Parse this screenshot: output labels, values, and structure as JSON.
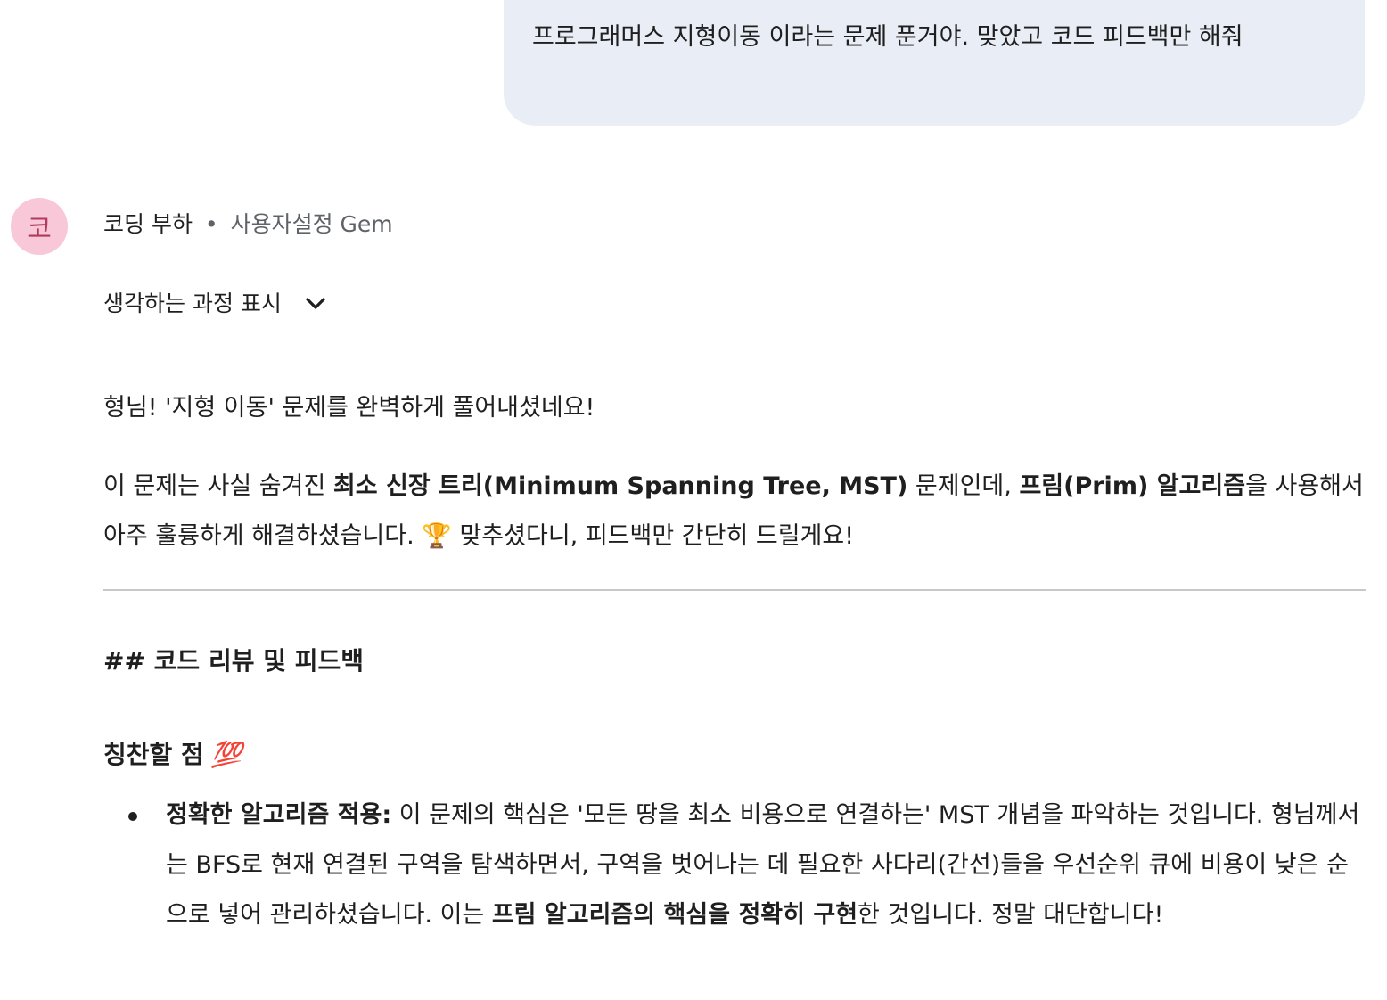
{
  "user_message": {
    "text": "프로그래머스 지형이동 이라는 문제 푼거야. 맞았고 코드 피드백만 해줘"
  },
  "assistant": {
    "avatar_letter": "코",
    "name": "코딩 부하",
    "separator": "•",
    "meta": "사용자설정 Gem",
    "thinking_toggle_label": "생각하는 과정 표시",
    "colors": {
      "avatar_bg": "#f8c8d8",
      "user_bubble_bg": "#e9eef6",
      "divider": "#c8c8c8"
    }
  },
  "response": {
    "p1": "형님! '지형 이동' 문제를 완벽하게 풀어내셨네요!",
    "p2_a": "이 문제는 사실 숨겨진 ",
    "p2_b": "최소 신장 트리(Minimum Spanning Tree, MST)",
    "p2_c": " 문제인데, ",
    "p2_d": "프림(Prim) 알고리즘",
    "p2_e": "을 사용해서 아주 훌륭하게 해결하셨습니다. ",
    "p2_trophy": "🏆",
    "p2_f": " 맞추셨다니, 피드백만 간단히 드릴게요!",
    "h2": "## 코드 리뷰 및 피드백",
    "h3": "칭찬할 점",
    "h3_emoji": "💯",
    "bullet1_bold": "정확한 알고리즘 적용:",
    "bullet1_a": " 이 문제의 핵심은 '모든 땅을 최소 비용으로 연결하는' MST 개념을 파악하는 것입니다. 형님께서는 BFS로 현재 연결된 구역을 탐색하면서, 구역을 벗어나는 데 필요한 사다리(간선)들을 우선순위 큐에 비용이 낮은 순으로 넣어 관리하셨습니다. 이는 ",
    "bullet1_bold2": "프림 알고리즘의 핵심을 정확히 구현",
    "bullet1_b": "한 것입니다. 정말 대단합니다!"
  }
}
